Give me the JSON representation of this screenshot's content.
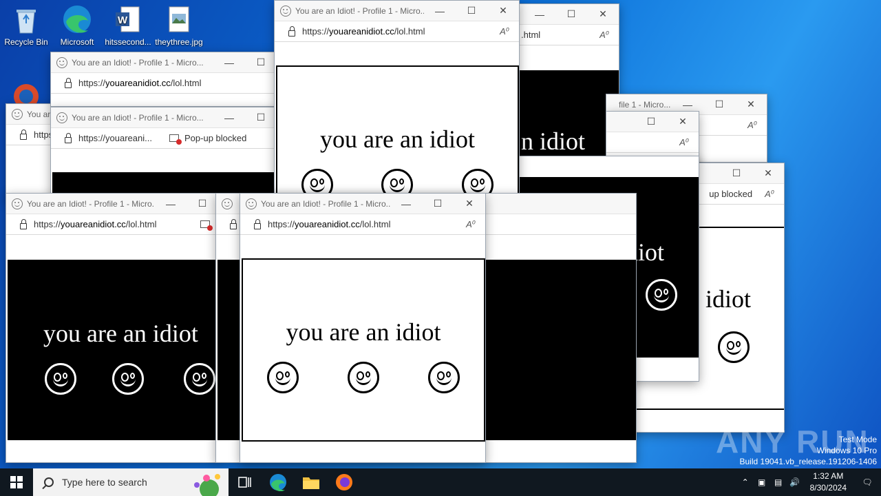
{
  "desktop": {
    "icons": [
      {
        "label": "Recycle Bin"
      },
      {
        "label": "Microsoft"
      },
      {
        "label": "hitssecond..."
      },
      {
        "label": "theythree.jpg"
      }
    ]
  },
  "popup": {
    "title": "You are an Idiot! - Profile 1 - Micro...",
    "url_prefix": "https://",
    "url_host": "youareanidiot.cc",
    "url_path": "/lol.html",
    "url_short": "https://youareani...",
    "url_tail": ".html",
    "title_tail": "file 1 - Micro...",
    "popup_blocked": "Pop-up blocked",
    "popup_blocked_tail": "up blocked",
    "message": "you are an idiot",
    "message_tail_1": "n idiot",
    "message_tail_2": "idiot",
    "message_tail_3": "diot",
    "read_aloud": "A⁰",
    "minimize": "—",
    "maximize": "☐",
    "close": "✕"
  },
  "taskbar": {
    "search_placeholder": "Type here to search",
    "time": "1:32 AM",
    "date": "8/30/2024"
  },
  "system": {
    "watermark": "ANY RUN",
    "test_mode": "Test Mode",
    "os": "Windows 10 Pro",
    "build": "Build 19041.vb_release.191206-1406"
  },
  "colors": {
    "desktop": "#0b6fd8",
    "taskbar": "#101820",
    "edge_blue": "#1a8ad4",
    "firefox_orange": "#ff7a1a"
  }
}
